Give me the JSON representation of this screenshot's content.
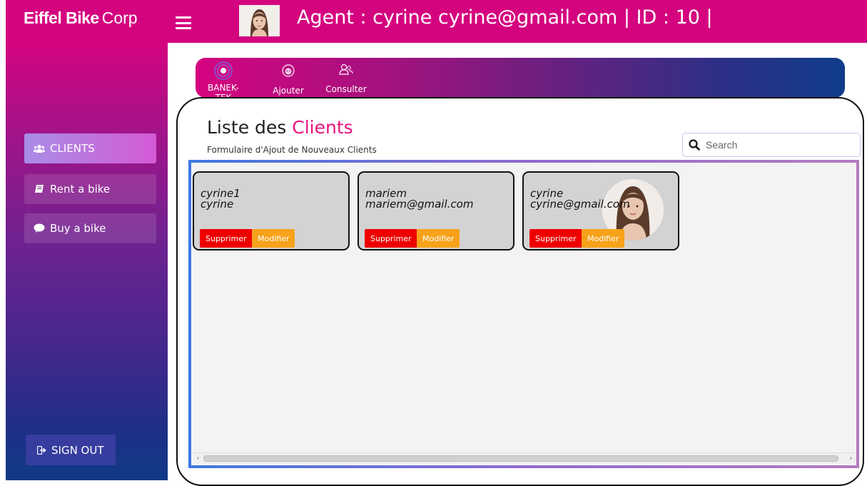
{
  "app": {
    "brand_bold": "Eiffel Bike",
    "brand_light": "Corp"
  },
  "header": {
    "agent_text": "Agent : cyrine cyrine@gmail.com | ID : 10 |"
  },
  "sidebar": {
    "items": [
      {
        "label": "CLIENTS",
        "icon": "users-icon",
        "active": true
      },
      {
        "label": "Rent a bike",
        "icon": "book-icon",
        "active": false
      },
      {
        "label": "Buy a bike",
        "icon": "comment-icon",
        "active": false
      }
    ],
    "signout_label": "SIGN OUT"
  },
  "topnav": {
    "items": [
      {
        "label": "BANEK-TEK",
        "icon": "target-icon"
      },
      {
        "label": "Ajouter",
        "icon": "face-icon"
      },
      {
        "label": "Consulter",
        "icon": "users-outline-icon"
      }
    ]
  },
  "page": {
    "title_prefix": "Liste des",
    "title_highlight": "Clients",
    "subtitle": "Formulaire d'Ajout de Nouveaux Clients"
  },
  "search": {
    "placeholder": "Search",
    "value": ""
  },
  "clients": [
    {
      "line1": "cyrine1",
      "line2": "cyrine",
      "has_photo": false
    },
    {
      "line1": "mariem",
      "line2": "mariem@gmail.com",
      "has_photo": false
    },
    {
      "line1": "cyrine",
      "line2": "cyrine@gmail.com",
      "has_photo": true
    }
  ],
  "actions": {
    "delete_label": "Supprimer",
    "edit_label": "Modifier"
  },
  "colors": {
    "primary": "#d4047f",
    "accent_pink": "#e8127f",
    "delete_red": "#ee0000",
    "edit_orange": "#f7a21a",
    "card_bg": "#d3d3d3"
  }
}
